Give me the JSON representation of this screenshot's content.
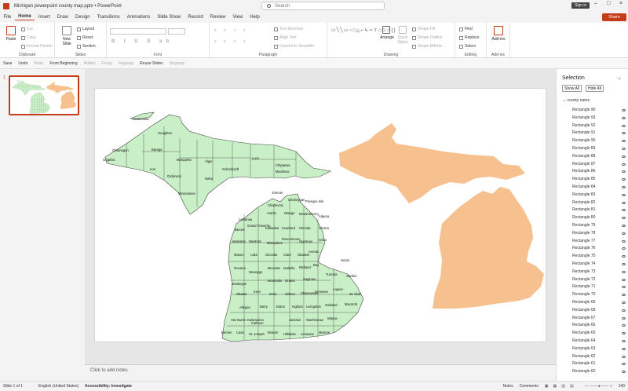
{
  "window": {
    "title": "Michigan powerpoint county map.pptx  •  PowerPoint",
    "search_placeholder": "Search",
    "sign_in": "Sign in"
  },
  "menu": {
    "items": [
      "File",
      "Home",
      "Insert",
      "Draw",
      "Design",
      "Transitions",
      "Animations",
      "Slide Show",
      "Record",
      "Review",
      "View",
      "Help"
    ],
    "share": "Share"
  },
  "ribbon": {
    "clipboard": {
      "label": "Clipboard",
      "paste": "Paste",
      "cut": "Cut",
      "copy": "Copy",
      "format_painter": "Format Painter"
    },
    "slides": {
      "label": "Slides",
      "new_slide": "New Slide",
      "layout": "Layout",
      "reset": "Reset",
      "section": "Section"
    },
    "font": {
      "label": "Font"
    },
    "paragraph": {
      "label": "Paragraph",
      "text_direction": "Text Direction",
      "align_text": "Align Text",
      "convert_smartart": "Convert to SmartArt"
    },
    "drawing": {
      "label": "Drawing",
      "arrange": "Arrange",
      "quick_styles": "Quick Styles",
      "shape_fill": "Shape Fill",
      "shape_outline": "Shape Outline",
      "shape_effects": "Shape Effects"
    },
    "editing": {
      "label": "Editing",
      "find": "Find",
      "replace": "Replace",
      "select": "Select"
    },
    "addins": {
      "label": "Add-ins",
      "addins": "Add-ins"
    }
  },
  "qat": {
    "save": "Save",
    "undo": "Undo",
    "redo": "Redo",
    "from_beginning": "From Beginning",
    "added": "Added",
    "group": "Group",
    "regroup": "Regroup",
    "reuse_slides": "Reuse Slides",
    "ungroup": "Ungroup"
  },
  "thumbnails": {
    "slide_number": "1"
  },
  "notes": {
    "placeholder": "Click to add notes"
  },
  "selection_pane": {
    "title": "Selection",
    "show_all": "Show All",
    "hide_all": "Hide All",
    "group_name": "county name",
    "rows": [
      "Rectangle 90",
      "Rectangle 93",
      "Rectangle 92",
      "Rectangle 91",
      "Rectangle 90",
      "Rectangle 89",
      "Rectangle 88",
      "Rectangle 87",
      "Rectangle 86",
      "Rectangle 85",
      "Rectangle 84",
      "Rectangle 83",
      "Rectangle 82",
      "Rectangle 81",
      "Rectangle 80",
      "Rectangle 79",
      "Rectangle 78",
      "Rectangle 77",
      "Rectangle 76",
      "Rectangle 75",
      "Rectangle 74",
      "Rectangle 73",
      "Rectangle 72",
      "Rectangle 71",
      "Rectangle 70",
      "Rectangle 69",
      "Rectangle 68",
      "Rectangle 67",
      "Rectangle 66",
      "Rectangle 65",
      "Rectangle 64",
      "Rectangle 63",
      "Rectangle 62",
      "Rectangle 61",
      "Rectangle 60"
    ]
  },
  "status": {
    "slide": "Slide 1 of 1",
    "language": "English (United States)",
    "accessibility": "Accessibility: Investigate",
    "notes": "Notes",
    "comments": "Comments",
    "zoom": "140"
  },
  "colors": {
    "accent": "#c43e1c",
    "green_map": "#c9efc6",
    "orange_map": "#f6c08f"
  },
  "map": {
    "counties": [
      "Keweenaw",
      "Houghton",
      "Baraga",
      "Ontonagon",
      "Gogebic",
      "Iron",
      "Marquette",
      "Alger",
      "Luce",
      "Chippewa",
      "Schoolcraft",
      "Mackinac",
      "Delta",
      "Dickinson",
      "Menominee",
      "Emmet",
      "Cheboygan",
      "Presque Isle",
      "Charlevoix",
      "Antrim",
      "Otsego",
      "Montmorency",
      "Alpena",
      "Leelanau",
      "Benzie",
      "Grand Traverse",
      "Kalkaska",
      "Crawford",
      "Oscoda",
      "Alcona",
      "Manistee",
      "Wexford",
      "Missaukee",
      "Roscommon",
      "Ogemaw",
      "Iosco",
      "Mason",
      "Lake",
      "Osceola",
      "Clare",
      "Gladwin",
      "Arenac",
      "Huron",
      "Oceana",
      "Newaygo",
      "Mecosta",
      "Isabella",
      "Midland",
      "Bay",
      "Tuscola",
      "Sanilac",
      "Muskegon",
      "Montcalm",
      "Gratiot",
      "Saginaw",
      "Lapeer",
      "St. Clair",
      "Ottawa",
      "Kent",
      "Ionia",
      "Clinton",
      "Shiawassee",
      "Genesee",
      "Macomb",
      "Allegan",
      "Barry",
      "Eaton",
      "Ingham",
      "Livingston",
      "Oakland",
      "Van Buren",
      "Kalamazoo",
      "Calhoun",
      "Jackson",
      "Washtenaw",
      "Wayne",
      "Berrien",
      "Cass",
      "St. Joseph",
      "Branch",
      "Hillsdale",
      "Lenawee",
      "Monroe"
    ]
  }
}
